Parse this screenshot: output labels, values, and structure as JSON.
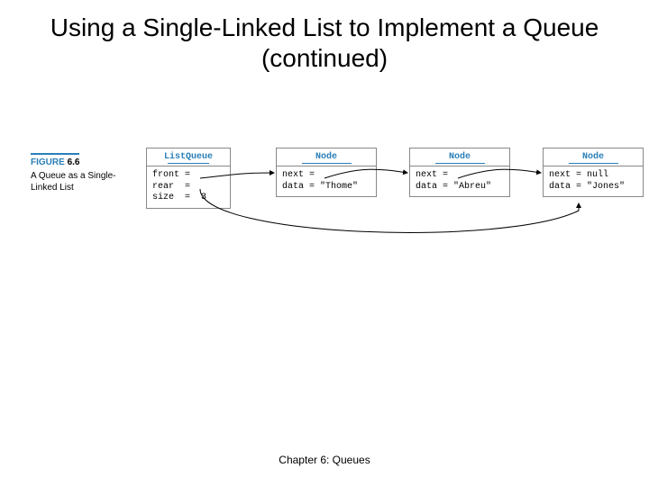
{
  "title": "Using a Single-Linked List to Implement a Queue (continued)",
  "figure": {
    "label_word": "FIGURE",
    "label_num": "6.6",
    "caption": "A Queue as a Single-Linked List"
  },
  "boxes": {
    "listqueue": {
      "header": "ListQueue",
      "body": "front =\nrear  =\nsize  =  3"
    },
    "node1": {
      "header": "Node",
      "body": "next =\ndata = \"Thome\""
    },
    "node2": {
      "header": "Node",
      "body": "next =\ndata = \"Abreu\""
    },
    "node3": {
      "header": "Node",
      "body": "next = null\ndata = \"Jones\""
    }
  },
  "footer": "Chapter 6: Queues"
}
